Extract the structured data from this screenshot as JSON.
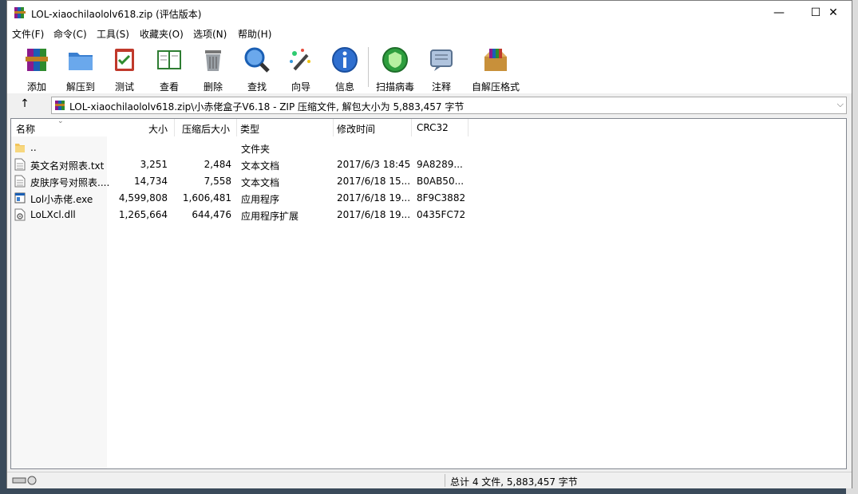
{
  "window": {
    "title": "LOL-xiaochilaololv618.zip (评估版本)",
    "controls": {
      "minimize": "—",
      "maximize": "☐",
      "close": "✕"
    }
  },
  "menu": [
    "文件(F)",
    "命令(C)",
    "工具(S)",
    "收藏夹(O)",
    "选项(N)",
    "帮助(H)"
  ],
  "toolbar": [
    {
      "label": "添加",
      "icon": "add-archive-icon"
    },
    {
      "label": "解压到",
      "icon": "extract-to-folder-icon"
    },
    {
      "label": "测试",
      "icon": "test-clipboard-icon"
    },
    {
      "label": "查看",
      "icon": "view-book-icon"
    },
    {
      "label": "删除",
      "icon": "delete-trash-icon"
    },
    {
      "label": "查找",
      "icon": "find-magnifier-icon"
    },
    {
      "label": "向导",
      "icon": "wizard-wand-icon"
    },
    {
      "label": "信息",
      "icon": "info-icon"
    },
    {
      "label": "扫描病毒",
      "icon": "virus-scan-icon"
    },
    {
      "label": "注释",
      "icon": "comment-icon"
    },
    {
      "label": "自解压格式",
      "icon": "sfx-box-icon"
    }
  ],
  "address": {
    "up": "↑",
    "path": "LOL-xiaochilaololv618.zip\\小赤佬盒子V6.18 - ZIP 压缩文件, 解包大小为 5,883,457 字节",
    "dropdown": "⌵"
  },
  "columns": {
    "name": "名称",
    "size": "大小",
    "packed": "压缩后大小",
    "type": "类型",
    "modified": "修改时间",
    "crc": "CRC32"
  },
  "files": [
    {
      "name": "..",
      "size": "",
      "packed": "",
      "type": "文件夹",
      "modified": "",
      "crc": "",
      "icon": "folder-icon"
    },
    {
      "name": "英文名对照表.txt",
      "size": "3,251",
      "packed": "2,484",
      "type": "文本文档",
      "modified": "2017/6/3 18:45",
      "crc": "9A8289...",
      "icon": "text-file-icon"
    },
    {
      "name": "皮肤序号对照表....",
      "size": "14,734",
      "packed": "7,558",
      "type": "文本文档",
      "modified": "2017/6/18 15...",
      "crc": "B0AB50...",
      "icon": "text-file-icon"
    },
    {
      "name": "Lol小赤佬.exe",
      "size": "4,599,808",
      "packed": "1,606,481",
      "type": "应用程序",
      "modified": "2017/6/18 19...",
      "crc": "8F9C3882",
      "icon": "exe-file-icon"
    },
    {
      "name": "LoLXcl.dll",
      "size": "1,265,664",
      "packed": "644,476",
      "type": "应用程序扩展",
      "modified": "2017/6/18 19...",
      "crc": "0435FC72",
      "icon": "dll-file-icon"
    }
  ],
  "status": {
    "summary": "总计 4 文件, 5,883,457 字节"
  }
}
